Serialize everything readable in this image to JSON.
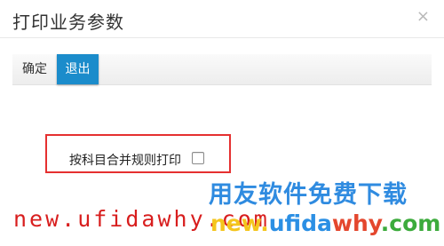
{
  "dialog": {
    "title": "打印业务参数",
    "close_glyph": "×"
  },
  "toolbar": {
    "confirm_label": "确定",
    "exit_label": "退出"
  },
  "options": {
    "merge_print_label": "按科目合并规则打印",
    "merge_print_checked": false
  },
  "watermark": {
    "title": "用友软件免费下载",
    "url_red": "new.ufidawhy.com",
    "url_color_part1": "new.",
    "url_color_part2": "ufida",
    "url_color_part3": "why",
    "url_color_part4": ".com"
  },
  "colors": {
    "exit_button_bg": "#1b8ccb",
    "highlight_border": "#e53030"
  }
}
